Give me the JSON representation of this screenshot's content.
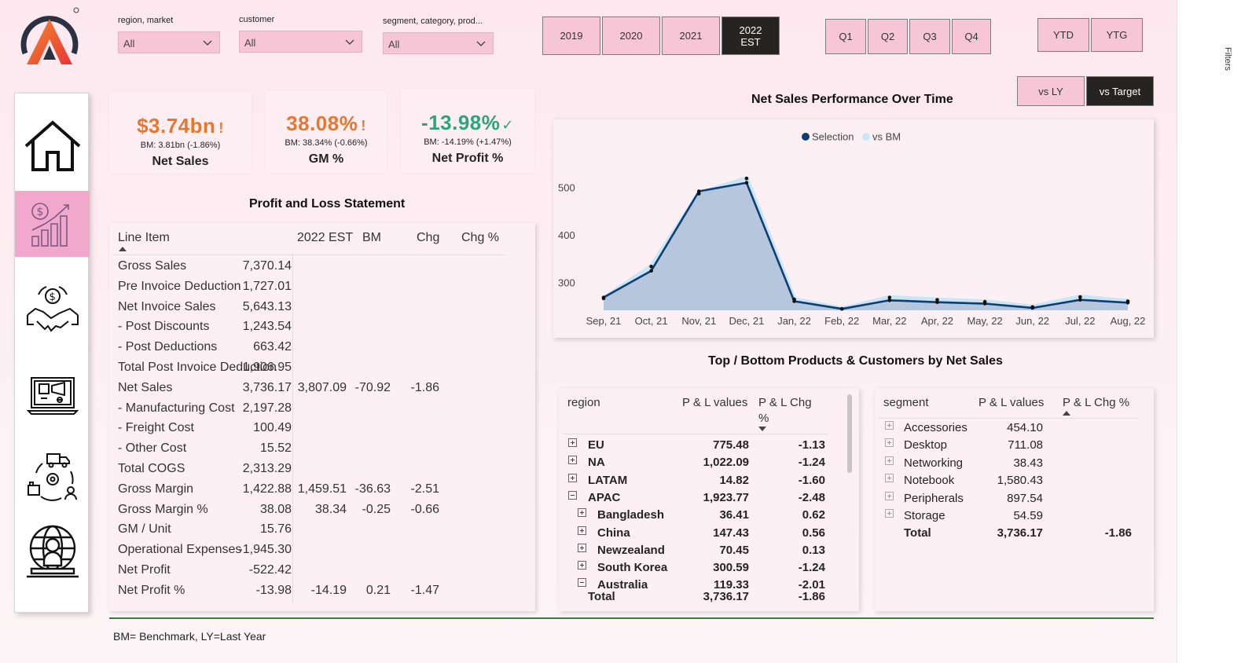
{
  "colors": {
    "accent_pink": "#f7c6d6",
    "dark": "#252423",
    "orange": "#e8772e",
    "green": "#2fa37c",
    "navy": "#0d3d73",
    "light_blue": "#c9e6f5"
  },
  "slicers": [
    {
      "label": "region, market",
      "value": "All"
    },
    {
      "label": "customer",
      "value": "All"
    },
    {
      "label": "segment, category, prod...",
      "value": "All"
    }
  ],
  "years": [
    "2019",
    "2020",
    "2021",
    "2022 EST"
  ],
  "year_selected": "2022 EST",
  "quarters": [
    "Q1",
    "Q2",
    "Q3",
    "Q4"
  ],
  "period": [
    "YTD",
    "YTG"
  ],
  "compare": {
    "options": [
      "vs LY",
      "vs Target"
    ],
    "selected": "vs Target"
  },
  "nav": [
    {
      "icon": "home-icon"
    },
    {
      "icon": "finance-chart-icon",
      "active": true
    },
    {
      "icon": "handshake-money-icon"
    },
    {
      "icon": "marketing-screen-icon"
    },
    {
      "icon": "supply-chain-icon"
    },
    {
      "icon": "executive-globe-icon"
    }
  ],
  "kpis": [
    {
      "value": "$3.74bn",
      "flag": "!",
      "bm": "BM: 3.81bn (-1.86%)",
      "label": "Net Sales",
      "color": "orange"
    },
    {
      "value": "38.08%",
      "flag": "!",
      "bm": "BM: 38.34% (-0.66%)",
      "label": "GM %",
      "color": "orange"
    },
    {
      "value": "-13.98%",
      "flag": "✓",
      "bm": "BM: -14.19% (+1.47%)",
      "label": "Net Profit %",
      "color": "green"
    }
  ],
  "pl": {
    "title": "Profit and Loss Statement",
    "columns": [
      "Line Item",
      "2022 EST",
      "BM",
      "Chg",
      "Chg %"
    ],
    "rows": [
      [
        "Gross Sales",
        "7,370.14",
        "",
        "",
        ""
      ],
      [
        "Pre Invoice Deduction",
        "1,727.01",
        "",
        "",
        ""
      ],
      [
        "Net Invoice Sales",
        "5,643.13",
        "",
        "",
        ""
      ],
      [
        "- Post Discounts",
        "1,243.54",
        "",
        "",
        ""
      ],
      [
        "- Post Deductions",
        "663.42",
        "",
        "",
        ""
      ],
      [
        "Total Post Invoice Deduction",
        "1,906.95",
        "",
        "",
        ""
      ],
      [
        "Net Sales",
        "3,736.17",
        "3,807.09",
        "-70.92",
        "-1.86"
      ],
      [
        "- Manufacturing Cost",
        "2,197.28",
        "",
        "",
        ""
      ],
      [
        "- Freight Cost",
        "100.49",
        "",
        "",
        ""
      ],
      [
        "- Other Cost",
        "15.52",
        "",
        "",
        ""
      ],
      [
        "Total COGS",
        "2,313.29",
        "",
        "",
        ""
      ],
      [
        "Gross Margin",
        "1,422.88",
        "1,459.51",
        "-36.63",
        "-2.51"
      ],
      [
        "Gross Margin %",
        "38.08",
        "38.34",
        "-0.25",
        "-0.66"
      ],
      [
        "GM / Unit",
        "15.76",
        "",
        "",
        ""
      ],
      [
        "Operational Expenses",
        "-1,945.30",
        "",
        "",
        ""
      ],
      [
        "Net Profit",
        "-522.42",
        "",
        "",
        ""
      ],
      [
        "Net Profit %",
        "-13.98",
        "-14.19",
        "0.21",
        "-1.47"
      ]
    ]
  },
  "chart_data": {
    "type": "area",
    "title": "Net Sales Performance Over Time",
    "xlabel": "",
    "ylabel": "",
    "categories": [
      "Sep, 21",
      "Oct, 21",
      "Nov, 21",
      "Dec, 21",
      "Jan, 22",
      "Feb, 22",
      "Mar, 22",
      "Apr, 22",
      "May, 22",
      "Jun, 22",
      "Jul, 22",
      "Aug, 22"
    ],
    "series": [
      {
        "name": "Selection",
        "values": [
          270,
          326,
          493,
          511,
          262,
          246,
          264,
          260,
          257,
          248,
          265,
          259
        ]
      },
      {
        "name": "vs BM",
        "values": [
          268,
          335,
          488,
          520,
          266,
          246,
          270,
          265,
          261,
          250,
          271,
          262
        ]
      }
    ],
    "yticks": [
      300,
      400,
      500
    ],
    "ylim": [
      243,
      545
    ],
    "legend": "top-center",
    "grid": false
  },
  "topbottom_title": "Top / Bottom Products & Customers by Net Sales",
  "region_table": {
    "columns": [
      "region",
      "P & L values",
      "P & L Chg",
      "%"
    ],
    "rows": [
      {
        "name": "EU",
        "value": "775.48",
        "chg": "-1.13",
        "level": 0,
        "expanded": false
      },
      {
        "name": "NA",
        "value": "1,022.09",
        "chg": "-1.24",
        "level": 0,
        "expanded": false
      },
      {
        "name": "LATAM",
        "value": "14.82",
        "chg": "-1.60",
        "level": 0,
        "expanded": false
      },
      {
        "name": "APAC",
        "value": "1,923.77",
        "chg": "-2.48",
        "level": 0,
        "expanded": true
      },
      {
        "name": "Bangladesh",
        "value": "36.41",
        "chg": "0.62",
        "level": 1,
        "expanded": false
      },
      {
        "name": "China",
        "value": "147.43",
        "chg": "0.56",
        "level": 1,
        "expanded": false
      },
      {
        "name": "Newzealand",
        "value": "70.45",
        "chg": "0.13",
        "level": 1,
        "expanded": false
      },
      {
        "name": "South Korea",
        "value": "300.59",
        "chg": "-1.24",
        "level": 1,
        "expanded": false
      },
      {
        "name": "Australia",
        "value": "119.33",
        "chg": "-2.01",
        "level": 1,
        "expanded": true
      }
    ],
    "total": {
      "name": "Total",
      "value": "3,736.17",
      "chg": "-1.86"
    }
  },
  "segment_table": {
    "columns": [
      "segment",
      "P & L values",
      "P & L Chg %"
    ],
    "rows": [
      {
        "name": "Accessories",
        "value": "454.10"
      },
      {
        "name": "Desktop",
        "value": "711.08"
      },
      {
        "name": "Networking",
        "value": "38.43"
      },
      {
        "name": "Notebook",
        "value": "1,580.43"
      },
      {
        "name": "Peripherals",
        "value": "897.54"
      },
      {
        "name": "Storage",
        "value": "54.59"
      }
    ],
    "total": {
      "name": "Total",
      "value": "3,736.17",
      "chg": "-1.86"
    }
  },
  "footer": "BM= Benchmark, LY=Last Year",
  "edge_label": "Filters"
}
